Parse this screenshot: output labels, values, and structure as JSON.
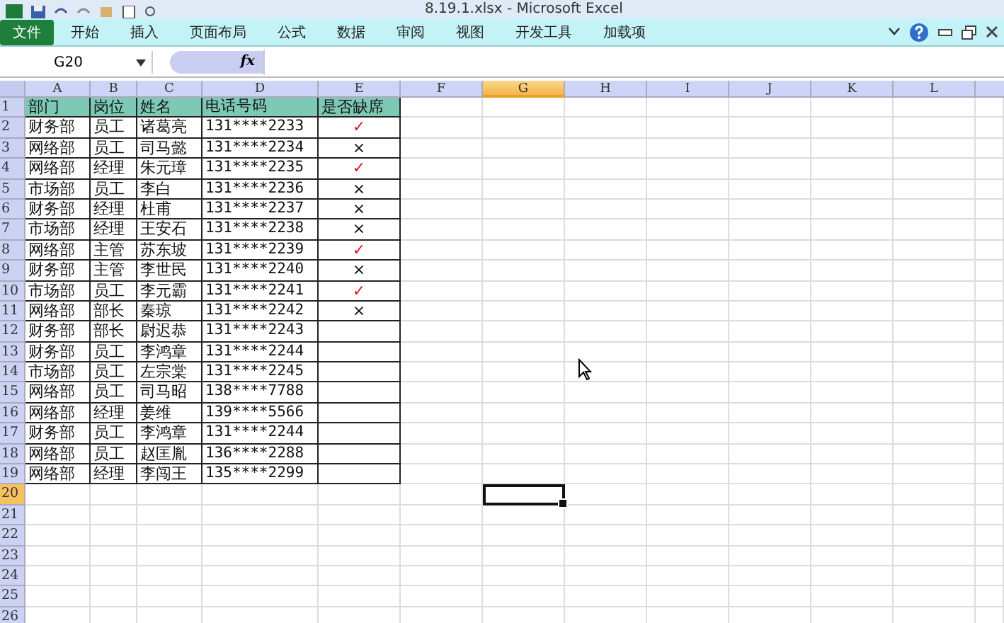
{
  "window": {
    "title": "8.19.1.xlsx - Microsoft Excel"
  },
  "ribbon_tabs": [
    {
      "label": "文件",
      "selected": true
    },
    {
      "label": "开始",
      "selected": false
    },
    {
      "label": "插入",
      "selected": false
    },
    {
      "label": "页面布局",
      "selected": false
    },
    {
      "label": "公式",
      "selected": false
    },
    {
      "label": "数据",
      "selected": false
    },
    {
      "label": "审阅",
      "selected": false
    },
    {
      "label": "视图",
      "selected": false
    },
    {
      "label": "开发工具",
      "selected": false
    },
    {
      "label": "加载项",
      "selected": false
    }
  ],
  "formula_bar": {
    "name_box": "G20",
    "fx": "fx"
  },
  "columns": [
    {
      "label": "A",
      "selected": false
    },
    {
      "label": "B",
      "selected": false
    },
    {
      "label": "C",
      "selected": false
    },
    {
      "label": "D",
      "selected": false
    },
    {
      "label": "E",
      "selected": false
    },
    {
      "label": "F",
      "selected": false
    },
    {
      "label": "G",
      "selected": true
    },
    {
      "label": "H",
      "selected": false
    },
    {
      "label": "I",
      "selected": false
    },
    {
      "label": "J",
      "selected": false
    },
    {
      "label": "K",
      "selected": false
    },
    {
      "label": "L",
      "selected": false
    }
  ],
  "rows": [
    {
      "number": "1",
      "selected": false,
      "kind": "header",
      "cells": [
        "部门",
        "岗位",
        "姓名",
        "电话号码",
        "是否缺席"
      ]
    },
    {
      "number": "2",
      "selected": false,
      "kind": "data",
      "cells": [
        "财务部",
        "员工",
        "诸葛亮",
        "131****2233"
      ],
      "mark": {
        "text": "✓",
        "kind": "check"
      }
    },
    {
      "number": "3",
      "selected": false,
      "kind": "data",
      "cells": [
        "网络部",
        "员工",
        "司马懿",
        "131****2234"
      ],
      "mark": {
        "text": "×",
        "kind": "cross"
      }
    },
    {
      "number": "4",
      "selected": false,
      "kind": "data",
      "cells": [
        "网络部",
        "经理",
        "朱元璋",
        "131****2235"
      ],
      "mark": {
        "text": "✓",
        "kind": "check"
      }
    },
    {
      "number": "5",
      "selected": false,
      "kind": "data",
      "cells": [
        "市场部",
        "员工",
        "李白",
        "131****2236"
      ],
      "mark": {
        "text": "×",
        "kind": "cross"
      }
    },
    {
      "number": "6",
      "selected": false,
      "kind": "data",
      "cells": [
        "财务部",
        "经理",
        "杜甫",
        "131****2237"
      ],
      "mark": {
        "text": "×",
        "kind": "cross"
      }
    },
    {
      "number": "7",
      "selected": false,
      "kind": "data",
      "cells": [
        "市场部",
        "经理",
        "王安石",
        "131****2238"
      ],
      "mark": {
        "text": "×",
        "kind": "cross"
      }
    },
    {
      "number": "8",
      "selected": false,
      "kind": "data",
      "cells": [
        "网络部",
        "主管",
        "苏东坡",
        "131****2239"
      ],
      "mark": {
        "text": "✓",
        "kind": "check"
      }
    },
    {
      "number": "9",
      "selected": false,
      "kind": "data",
      "cells": [
        "财务部",
        "主管",
        "李世民",
        "131****2240"
      ],
      "mark": {
        "text": "×",
        "kind": "cross"
      }
    },
    {
      "number": "10",
      "selected": false,
      "kind": "data",
      "cells": [
        "市场部",
        "员工",
        "李元霸",
        "131****2241"
      ],
      "mark": {
        "text": "✓",
        "kind": "check"
      }
    },
    {
      "number": "11",
      "selected": false,
      "kind": "data",
      "cells": [
        "网络部",
        "部长",
        "秦琼",
        "131****2242"
      ],
      "mark": {
        "text": "×",
        "kind": "cross"
      }
    },
    {
      "number": "12",
      "selected": false,
      "kind": "data",
      "cells": [
        "财务部",
        "部长",
        "尉迟恭",
        "131****2243"
      ]
    },
    {
      "number": "13",
      "selected": false,
      "kind": "data",
      "cells": [
        "财务部",
        "员工",
        "李鸿章",
        "131****2244"
      ]
    },
    {
      "number": "14",
      "selected": false,
      "kind": "data",
      "cells": [
        "市场部",
        "员工",
        "左宗棠",
        "131****2245"
      ]
    },
    {
      "number": "15",
      "selected": false,
      "kind": "data",
      "cells": [
        "网络部",
        "员工",
        "司马昭",
        "138****7788"
      ]
    },
    {
      "number": "16",
      "selected": false,
      "kind": "data",
      "cells": [
        "网络部",
        "经理",
        "姜维",
        "139****5566"
      ]
    },
    {
      "number": "17",
      "selected": false,
      "kind": "data",
      "cells": [
        "财务部",
        "员工",
        "李鸿章",
        "131****2244"
      ]
    },
    {
      "number": "18",
      "selected": false,
      "kind": "data",
      "cells": [
        "网络部",
        "员工",
        "赵匡胤",
        "136****2288"
      ]
    },
    {
      "number": "19",
      "selected": false,
      "kind": "data",
      "cells": [
        "网络部",
        "经理",
        "李闯王",
        "135****2299"
      ]
    },
    {
      "number": "20",
      "selected": true,
      "kind": "empty"
    },
    {
      "number": "21",
      "selected": false,
      "kind": "empty"
    },
    {
      "number": "22",
      "selected": false,
      "kind": "empty"
    },
    {
      "number": "23",
      "selected": false,
      "kind": "empty"
    },
    {
      "number": "24",
      "selected": false,
      "kind": "empty"
    },
    {
      "number": "25",
      "selected": false,
      "kind": "empty"
    },
    {
      "number": "26",
      "selected": false,
      "kind": "empty"
    }
  ]
}
